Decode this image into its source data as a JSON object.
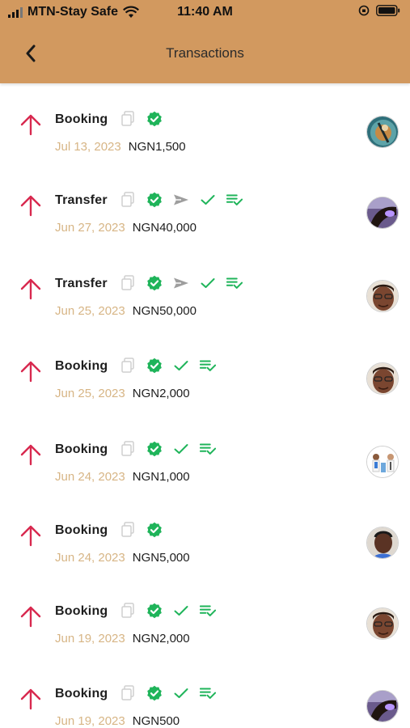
{
  "status_bar": {
    "carrier": "MTN-Stay Safe",
    "time": "11:40 AM"
  },
  "header": {
    "title": "Transactions"
  },
  "colors": {
    "header_bg": "#d2995f",
    "arrow": "#d8294f",
    "verified": "#1fb45a",
    "date": "#d7b585"
  },
  "transactions": [
    {
      "type": "Booking",
      "date": "Jul 13, 2023",
      "amount": "NGN1,500"
    },
    {
      "type": "Transfer",
      "date": "Jun 27, 2023",
      "amount": "NGN40,000"
    },
    {
      "type": "Transfer",
      "date": "Jun 25, 2023",
      "amount": "NGN50,000"
    },
    {
      "type": "Booking",
      "date": "Jun 25, 2023",
      "amount": "NGN2,000"
    },
    {
      "type": "Booking",
      "date": "Jun 24, 2023",
      "amount": "NGN1,000"
    },
    {
      "type": "Booking",
      "date": "Jun 24, 2023",
      "amount": "NGN5,000"
    },
    {
      "type": "Booking",
      "date": "Jun 19, 2023",
      "amount": "NGN2,000"
    },
    {
      "type": "Booking",
      "date": "Jun 19, 2023",
      "amount": "NGN500"
    }
  ]
}
